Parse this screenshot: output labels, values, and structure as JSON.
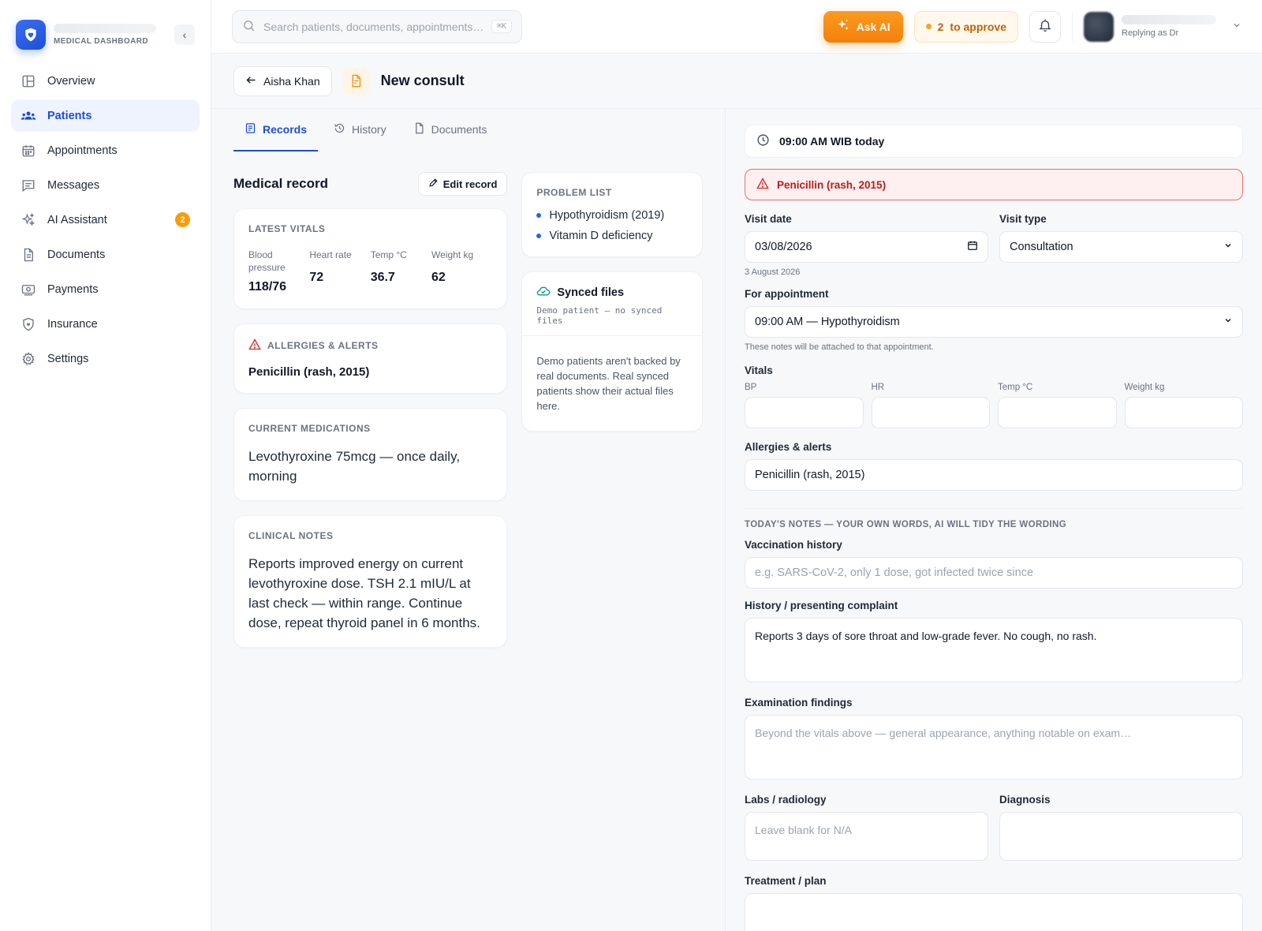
{
  "brand": {
    "subtitle": "MEDICAL DASHBOARD"
  },
  "sidebar": {
    "items": [
      {
        "label": "Overview",
        "icon": "layout-icon",
        "active": false
      },
      {
        "label": "Patients",
        "icon": "users-icon",
        "active": true
      },
      {
        "label": "Appointments",
        "icon": "calendar-icon",
        "active": false
      },
      {
        "label": "Messages",
        "icon": "message-icon",
        "active": false
      },
      {
        "label": "AI Assistant",
        "icon": "sparkle-icon",
        "active": false,
        "badge": "2"
      },
      {
        "label": "Documents",
        "icon": "document-icon",
        "active": false
      },
      {
        "label": "Payments",
        "icon": "payment-icon",
        "active": false
      },
      {
        "label": "Insurance",
        "icon": "shield-icon",
        "active": false
      },
      {
        "label": "Settings",
        "icon": "gear-icon",
        "active": false
      }
    ]
  },
  "topbar": {
    "search_placeholder": "Search patients, documents, appointments…",
    "search_shortcut": "⌘K",
    "ask_ai": "Ask AI",
    "approve_count": "2",
    "approve_label": "to approve",
    "user_sub": "Replying as Dr"
  },
  "page": {
    "back_label": "Aisha Khan",
    "title": "New consult"
  },
  "tabs": [
    {
      "label": "Records",
      "active": true
    },
    {
      "label": "History",
      "active": false
    },
    {
      "label": "Documents",
      "active": false
    }
  ],
  "record": {
    "title": "Medical record",
    "edit_label": "Edit record",
    "vitals_label": "LATEST VITALS",
    "vitals": [
      {
        "label": "Blood pressure",
        "value": "118/76"
      },
      {
        "label": "Heart rate",
        "value": "72"
      },
      {
        "label": "Temp °C",
        "value": "36.7"
      },
      {
        "label": "Weight kg",
        "value": "62"
      }
    ],
    "allergies_label": "ALLERGIES & ALERTS",
    "allergies_value": "Penicillin (rash, 2015)",
    "meds_label": "CURRENT MEDICATIONS",
    "meds_value": "Levothyroxine 75mcg — once daily, morning",
    "notes_label": "CLINICAL NOTES",
    "notes_value": "Reports improved energy on current levothyroxine dose. TSH 2.1 mIU/L at last check — within range. Continue dose, repeat thyroid panel in 6 months."
  },
  "problems": {
    "label": "PROBLEM LIST",
    "items": [
      "Hypothyroidism (2019)",
      "Vitamin D deficiency"
    ]
  },
  "synced": {
    "title": "Synced files",
    "mono": "Demo patient — no synced files",
    "body": "Demo patients aren't backed by real documents. Real synced patients show their actual files here."
  },
  "form": {
    "appt_time": "09:00 AM WIB today",
    "alert": "Penicillin (rash, 2015)",
    "visit_date_label": "Visit date",
    "visit_date_value": "03/08/2026",
    "visit_date_sub": "3 August 2026",
    "visit_type_label": "Visit type",
    "visit_type_value": "Consultation",
    "appointment_label": "For appointment",
    "appointment_value": "09:00 AM — Hypothyroidism",
    "appointment_sub": "These notes will be attached to that appointment.",
    "vitals_label": "Vitals",
    "vitals_fields": [
      "BP",
      "HR",
      "Temp °C",
      "Weight kg"
    ],
    "allergies_label": "Allergies & alerts",
    "allergies_value": "Penicillin (rash, 2015)",
    "notes_caption": "TODAY'S NOTES — YOUR OWN WORDS, AI WILL TIDY THE WORDING",
    "vaccination_label": "Vaccination history",
    "vaccination_placeholder": "e.g. SARS-CoV-2, only 1 dose, got infected twice since",
    "history_label": "History / presenting complaint",
    "history_value": "Reports 3 days of sore throat and low-grade fever. No cough, no rash.",
    "exam_label": "Examination findings",
    "exam_placeholder": "Beyond the vitals above — general appearance, anything notable on exam…",
    "labs_label": "Labs / radiology",
    "labs_placeholder": "Leave blank for N/A",
    "diagnosis_label": "Diagnosis",
    "treatment_label": "Treatment / plan"
  },
  "colors": {
    "accent": "#1d4ed8",
    "orange": "#f57f0a",
    "alert": "#ef6b6b"
  }
}
